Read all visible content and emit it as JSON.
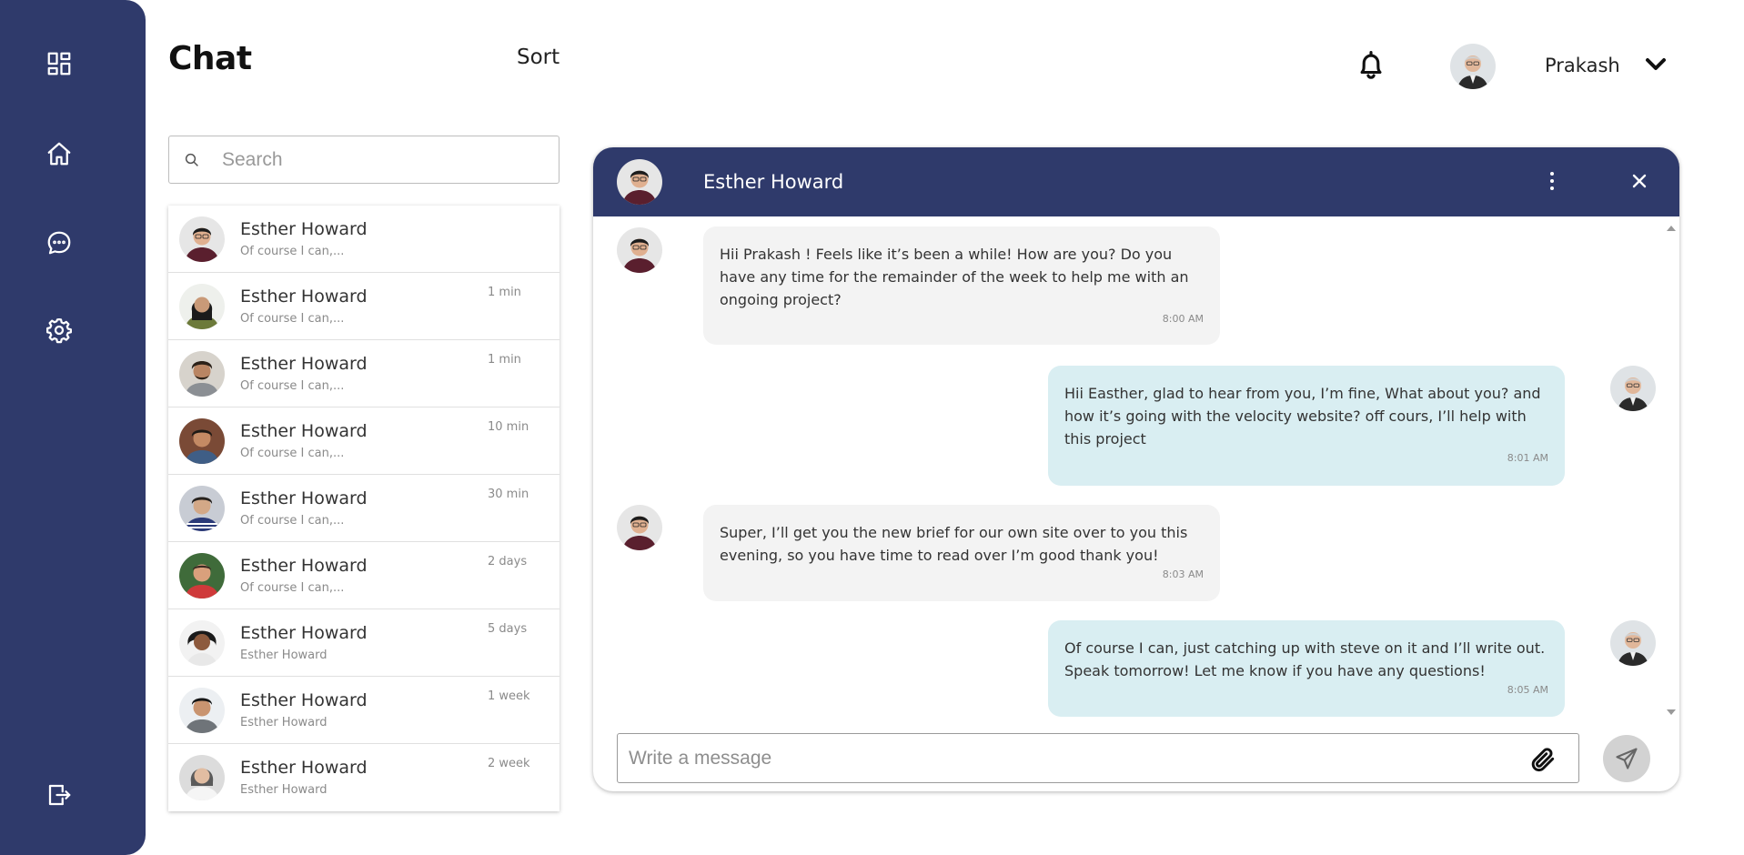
{
  "header": {
    "title": "Chat",
    "sort_label": "Sort",
    "user_name": "Prakash"
  },
  "search": {
    "placeholder": "Search",
    "value": ""
  },
  "conversations": [
    {
      "name": "Esther Howard",
      "preview": "Of course I can,...",
      "time": ""
    },
    {
      "name": "Esther Howard",
      "preview": "Of course I can,...",
      "time": "1 min"
    },
    {
      "name": "Esther Howard",
      "preview": "Of course I can,...",
      "time": "1 min"
    },
    {
      "name": "Esther Howard",
      "preview": "Of course I can,...",
      "time": "10 min"
    },
    {
      "name": "Esther Howard",
      "preview": "Of course I can,...",
      "time": "30 min"
    },
    {
      "name": "Esther Howard",
      "preview": "Of course I can,...",
      "time": "2 days"
    },
    {
      "name": "Esther Howard",
      "preview": "Esther Howard",
      "time": "5 days"
    },
    {
      "name": "Esther Howard",
      "preview": "Esther Howard",
      "time": "1 week"
    },
    {
      "name": "Esther Howard",
      "preview": "Esther Howard",
      "time": "2 week"
    }
  ],
  "chat": {
    "contact_name": "Esther Howard",
    "messages": [
      {
        "direction": "incoming",
        "text": "Hii Prakash ! Feels like it’s been a while! How are you? Do you have any time for the remainder of the week to help me with an ongoing project?",
        "time": "8:00 AM"
      },
      {
        "direction": "outgoing",
        "text": "Hii Easther, glad to hear from you, I’m fine, What about you? and how it’s going with the velocity website? off cours, I’ll help with this project",
        "time": "8:01 AM"
      },
      {
        "direction": "incoming",
        "text": "Super, I’ll get you the new brief for our own site over to you this evening, so you have time to read over I’m good thank you!",
        "time": "8:03 AM"
      },
      {
        "direction": "outgoing",
        "text": "Of course I can, just catching up with steve on it and I’ll write out. Speak tomorrow! Let me know if you have any questions!",
        "time": "8:05 AM"
      }
    ],
    "composer_placeholder": "Write a message",
    "composer_value": ""
  },
  "icons": {
    "sidebar": [
      "dashboard-icon",
      "home-icon",
      "chat-icon",
      "settings-icon",
      "logout-icon"
    ],
    "header": [
      "bell-icon",
      "chevron-down-icon"
    ],
    "chat": [
      "more-vertical-icon",
      "close-icon",
      "paperclip-icon",
      "send-icon",
      "search-icon"
    ]
  },
  "colors": {
    "sidebar": "#2f3a6b",
    "chat_header": "#2f3a6b",
    "incoming_bubble": "#f3f3f3",
    "outgoing_bubble": "#d9eef2",
    "send_button": "#d2d2d2"
  }
}
